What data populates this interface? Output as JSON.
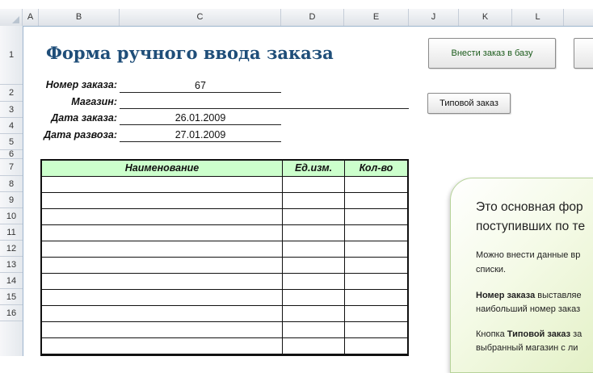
{
  "columns": [
    "A",
    "B",
    "C",
    "D",
    "E",
    "J",
    "K",
    "L"
  ],
  "rows": [
    "1",
    "2",
    "3",
    "4",
    "5",
    "6",
    "7",
    "8",
    "9",
    "10",
    "11",
    "12",
    "13",
    "14",
    "15",
    "16"
  ],
  "sheet": {
    "title": "Форма ручного ввода заказа",
    "fields": [
      {
        "label": "Номер заказа:",
        "value": "67"
      },
      {
        "label": "Магазин:",
        "value": ""
      },
      {
        "label": "Дата заказа:",
        "value": "26.01.2009"
      },
      {
        "label": "Дата развоза:",
        "value": "27.01.2009"
      }
    ],
    "buttons": {
      "submit": "Внести заказ в базу",
      "template": "Типовой заказ"
    },
    "table": {
      "headers": [
        "Наименование",
        "Ед.изм.",
        "Кол-во"
      ],
      "header_bg": "#ccffcc",
      "empty_rows": 11
    }
  },
  "info_panel": {
    "heading_lines": [
      "Это основная фор",
      "поступивших по те"
    ],
    "paragraphs": [
      [
        "Можно внести данные вр",
        "списки."
      ],
      [
        "Номер заказа выставляе",
        "наибольший номер заказ"
      ],
      [
        "Кнопка Типовой заказ за",
        "выбранный магазин с ли"
      ]
    ]
  },
  "colors": {
    "title": "#1f4e79",
    "panel_border": "#b7d39a"
  }
}
